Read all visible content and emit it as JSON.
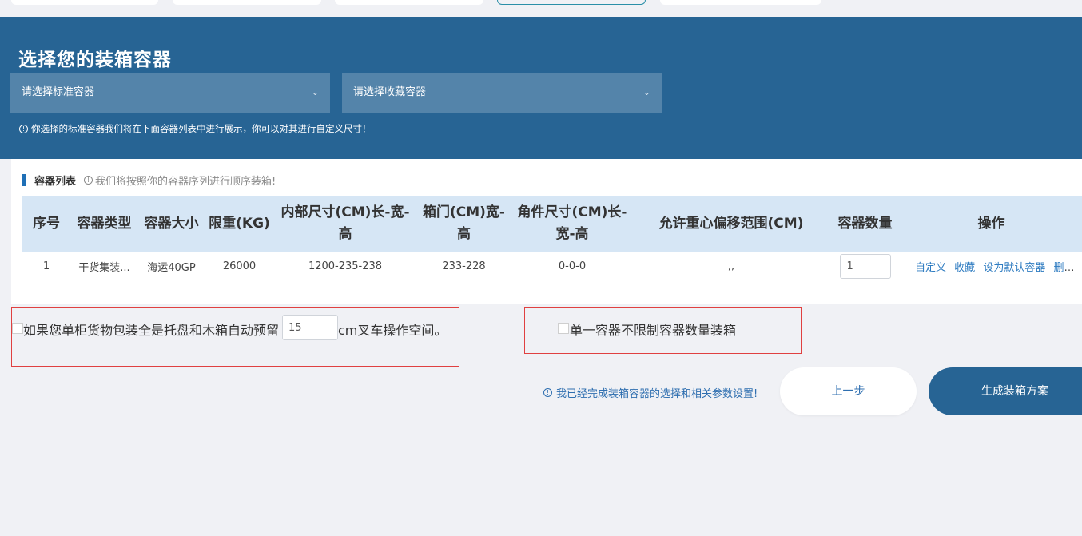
{
  "banner": {
    "title": "选择您的装箱容器",
    "standard_select": "请选择标准容器",
    "favorite_select": "请选择收藏容器",
    "hint": "你选择的标准容器我们将在下面容器列表中进行展示，你可以对其进行自定义尺寸！"
  },
  "container_list": {
    "title": "容器列表",
    "subtitle": "我们将按照你的容器序列进行顺序装箱!",
    "columns": [
      "序号",
      "容器类型",
      "容器大小",
      "限重(KG)",
      "内部尺寸(CM)长-宽-高",
      "箱门(CM)宽-高",
      "角件尺寸(CM)长-宽-高",
      "允许重心偏移范围(CM)",
      "容器数量",
      "操作"
    ],
    "rows": [
      {
        "index": "1",
        "type": "干货集装...",
        "size": "海运40GP",
        "max_weight": "26000",
        "inner_dims": "1200-235-238",
        "door": "233-228",
        "corner": "0-0-0",
        "cg_offset": ",,",
        "quantity": "1",
        "actions": [
          "自定义",
          "收藏",
          "设为默认容器",
          "删除"
        ]
      }
    ]
  },
  "options": {
    "pallet_prefix": "如果您单柜货物包装全是托盘和木箱自动预留",
    "pallet_value": "15",
    "pallet_suffix": "cm叉车操作空间。",
    "single_container": "单一容器不限制容器数量装箱"
  },
  "footer": {
    "done_hint": "我已经完成装箱容器的选择和相关参数设置!",
    "prev_label": "上一步",
    "generate_label": "生成装箱方案"
  },
  "colors": {
    "banner": "#276494",
    "table_header": "#d6e6f5",
    "link": "#2f7cc1",
    "highlight_border": "#e04040"
  }
}
